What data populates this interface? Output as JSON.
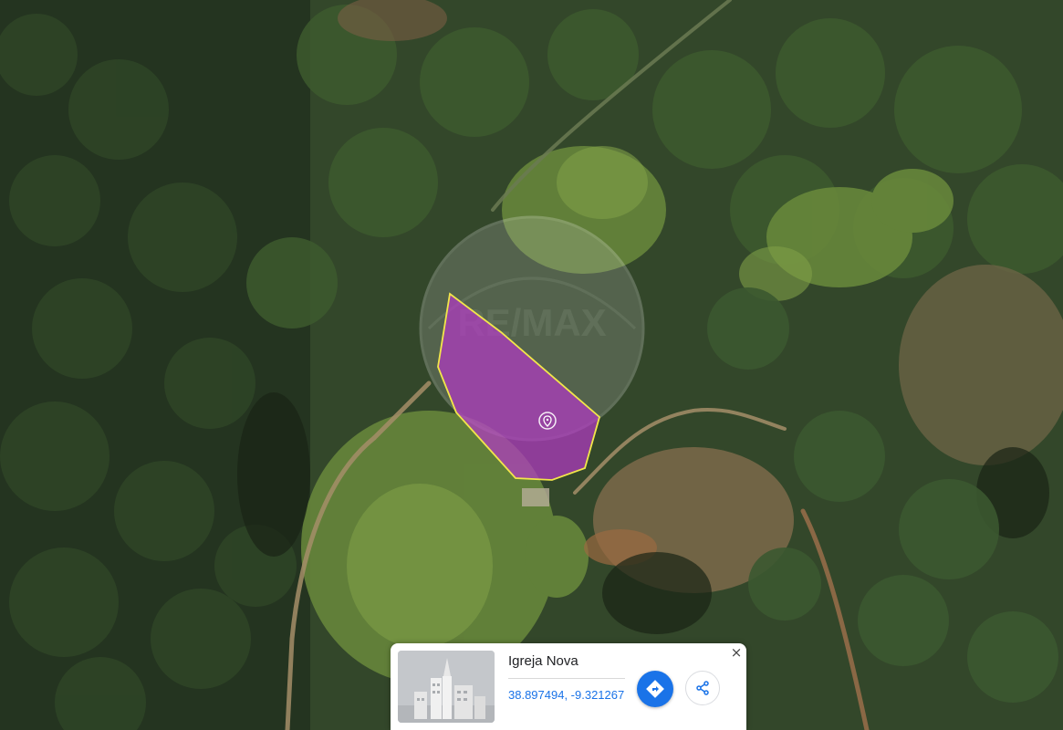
{
  "map": {
    "view": "satellite",
    "watermark": "RE/MAX",
    "parcel_fill": "#b23ac4",
    "parcel_stroke": "#f2e64a",
    "marker_icon": "map-pin-icon"
  },
  "info_card": {
    "title": "Igreja Nova",
    "coordinates": "38.897494, -9.321267",
    "close_label": "×",
    "directions_icon": "directions-icon",
    "share_icon": "share-icon",
    "accent_color": "#1a73e8",
    "thumbnail_icon": "city-placeholder-icon"
  }
}
